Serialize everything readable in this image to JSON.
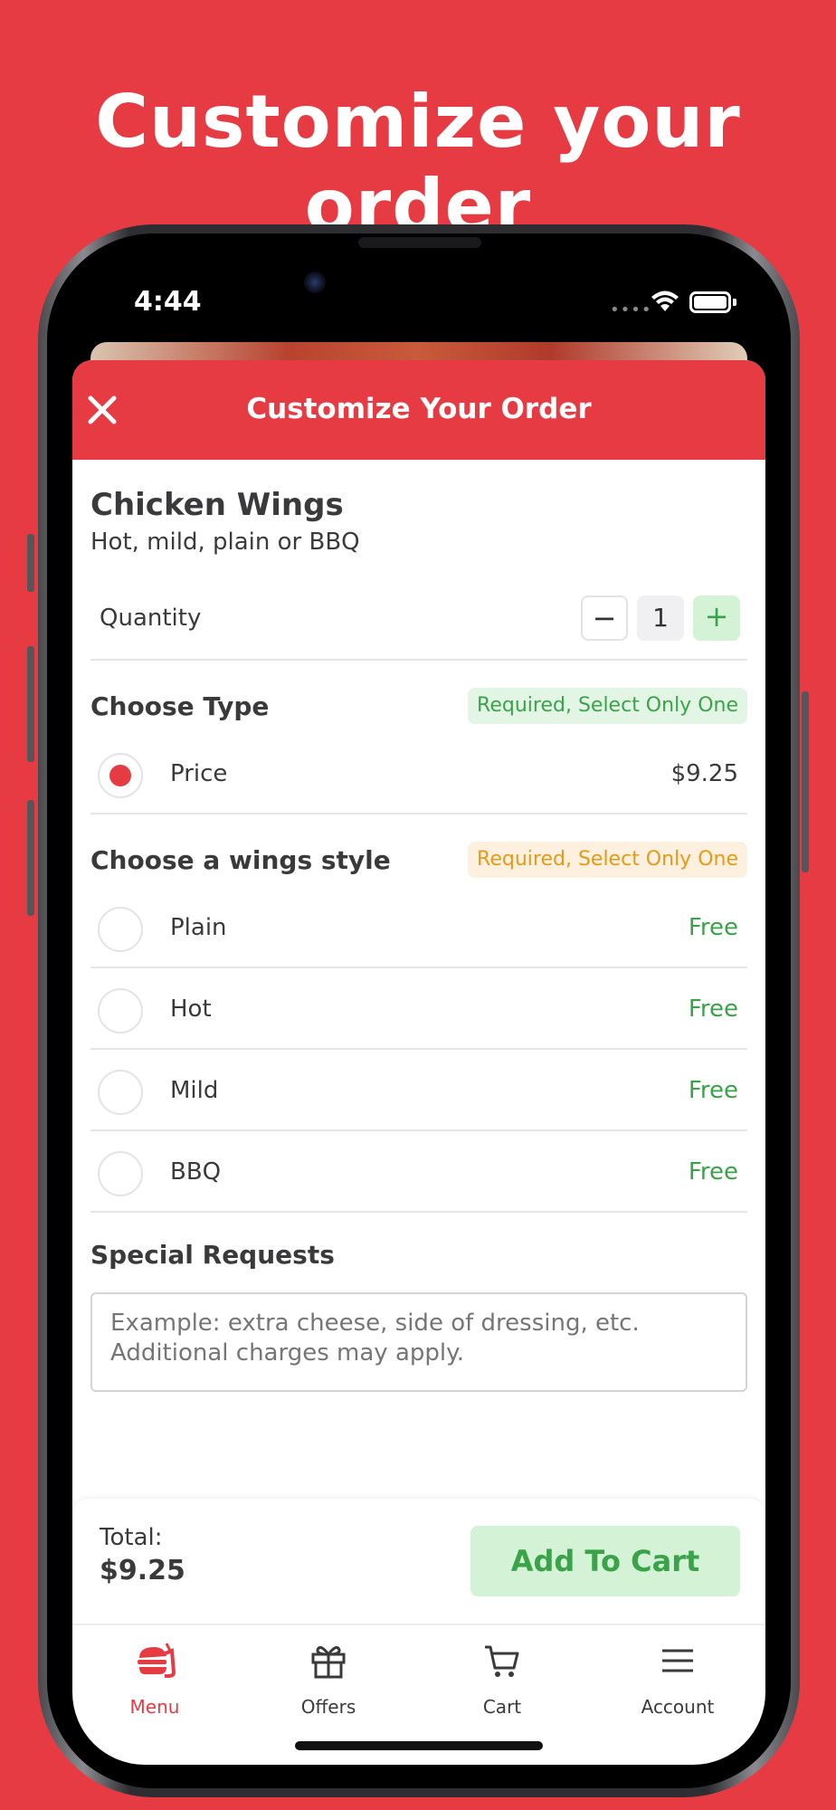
{
  "headline": "Customize your order",
  "status_bar": {
    "time": "4:44"
  },
  "sheet": {
    "title": "Customize Your Order",
    "item_name": "Chicken Wings",
    "item_description": "Hot, mild, plain or BBQ"
  },
  "quantity": {
    "label": "Quantity",
    "value": "1",
    "minus": "−",
    "plus": "+"
  },
  "choose_type": {
    "title": "Choose Type",
    "badge": "Required, Select Only One",
    "options": [
      {
        "label": "Price",
        "price": "$9.25",
        "selected": true
      }
    ]
  },
  "wings_style": {
    "title": "Choose a wings style",
    "badge": "Required, Select Only One",
    "options": [
      {
        "label": "Plain",
        "price": "Free"
      },
      {
        "label": "Hot",
        "price": "Free"
      },
      {
        "label": "Mild",
        "price": "Free"
      },
      {
        "label": "BBQ",
        "price": "Free"
      }
    ]
  },
  "special_requests": {
    "title": "Special Requests",
    "placeholder": "Example: extra cheese, side of dressing, etc. Additional charges may apply."
  },
  "footer": {
    "total_label": "Total:",
    "total_value": "$9.25",
    "add_button": "Add To Cart"
  },
  "tabs": [
    {
      "label": "Menu",
      "icon": "burger-icon",
      "active": true
    },
    {
      "label": "Offers",
      "icon": "gift-icon"
    },
    {
      "label": "Cart",
      "icon": "cart-icon"
    },
    {
      "label": "Account",
      "icon": "menu-lines-icon"
    }
  ],
  "colors": {
    "brand_red": "#e63b43",
    "success_green": "#3aa34a",
    "badge_green_bg": "#e3f5e4",
    "badge_orange_bg": "#fdf0de",
    "badge_orange_text": "#e39a1a"
  }
}
